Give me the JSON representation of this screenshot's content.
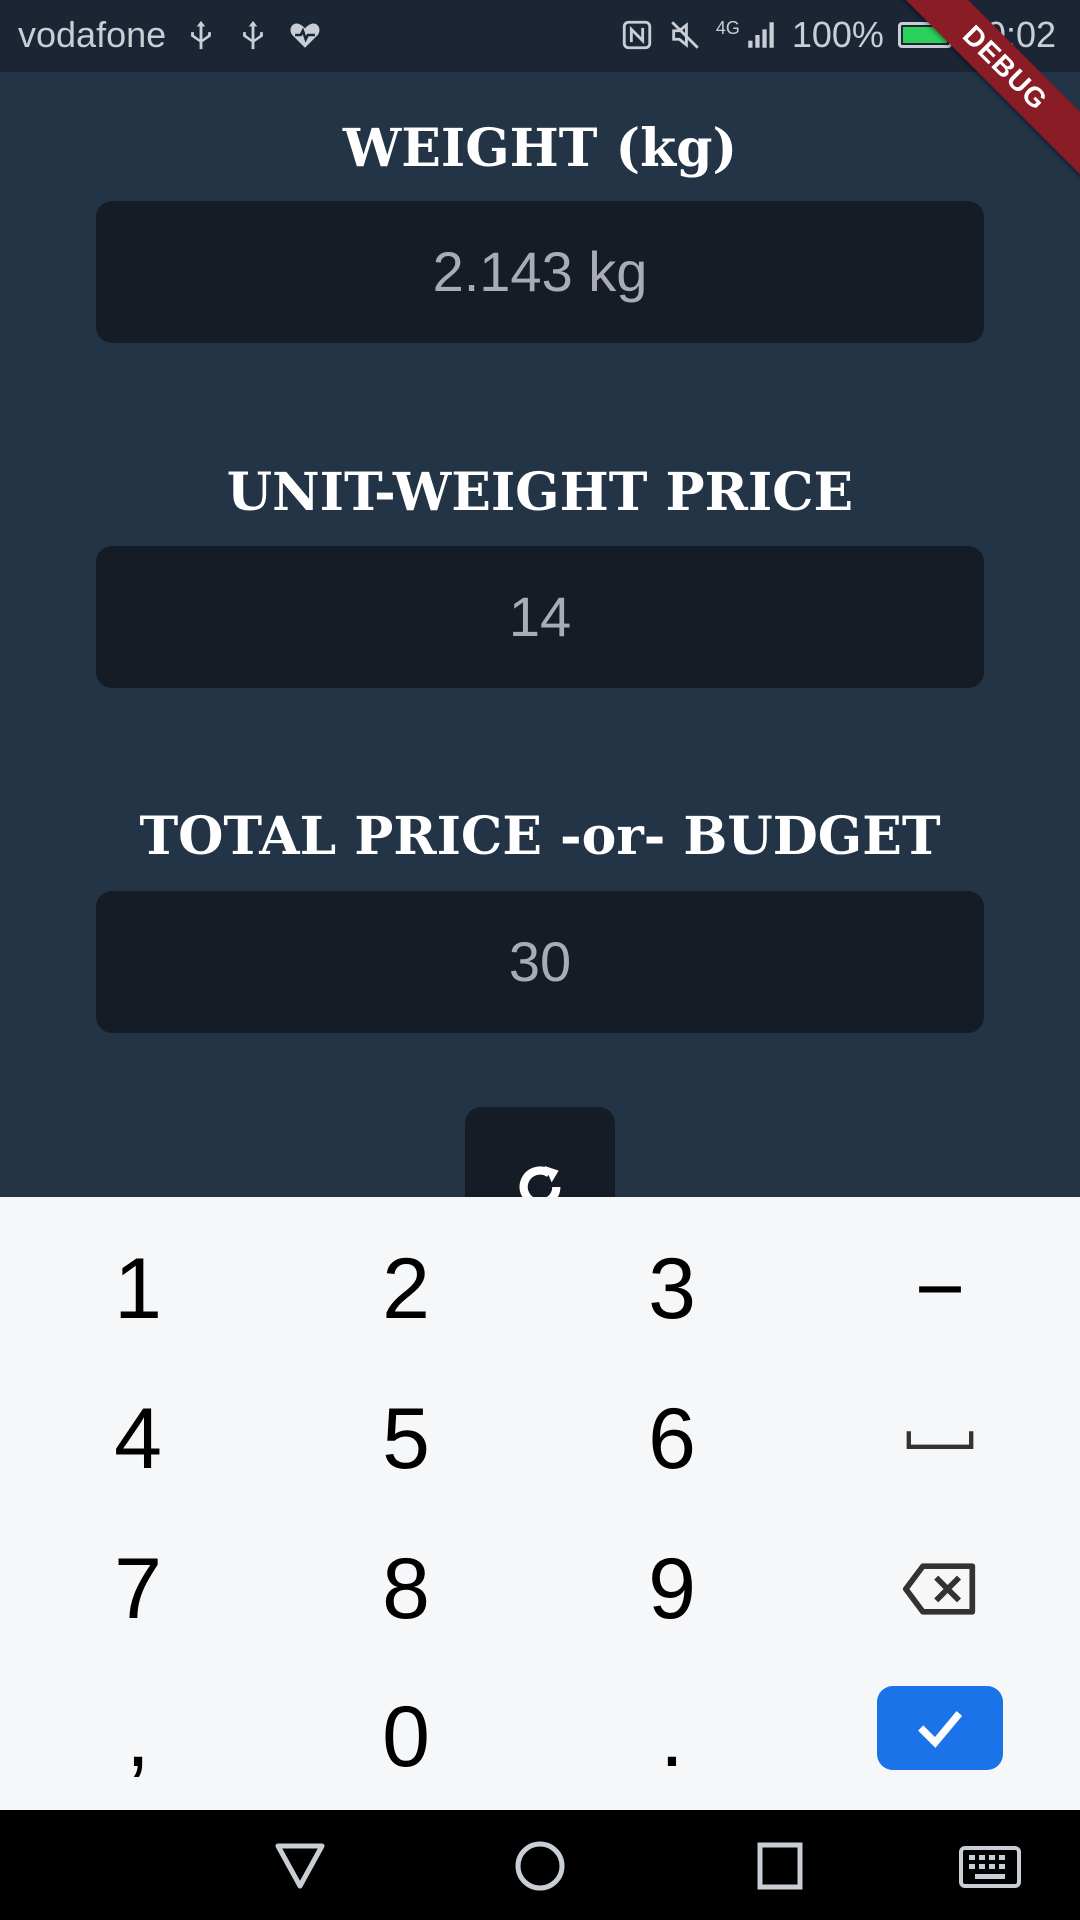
{
  "status_bar": {
    "carrier": "vodafone",
    "network": "4G",
    "battery": "100%",
    "time": "20:02",
    "icons": [
      "usb-icon",
      "usb-icon",
      "heart-icon",
      "nfc-icon",
      "mute-icon",
      "signal-icon",
      "battery-icon"
    ]
  },
  "debug_banner": "DEBUG",
  "form": {
    "weight_label": "WEIGHT (kg)",
    "weight_value": "2.143 kg",
    "unit_price_label": "UNIT-WEIGHT PRICE",
    "unit_price_value": "14",
    "total_label": "TOTAL PRICE -or- BUDGET",
    "total_value": "30",
    "refresh_icon": "refresh-icon"
  },
  "keyboard": {
    "row1": [
      "1",
      "2",
      "3",
      "−"
    ],
    "row2": [
      "4",
      "5",
      "6",
      "␣"
    ],
    "row3": [
      "7",
      "8",
      "9",
      "backspace"
    ],
    "row4": [
      ",",
      "0",
      ".",
      "done"
    ],
    "accent": "#1a73e8"
  },
  "nav": [
    "back-icon",
    "home-icon",
    "recents-icon",
    "keyboard-icon"
  ]
}
